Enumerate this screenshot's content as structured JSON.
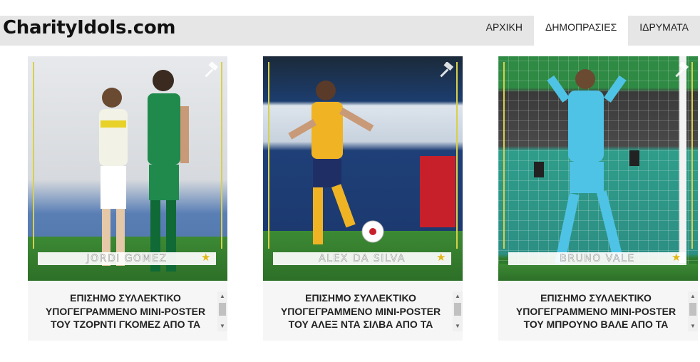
{
  "site": {
    "logo": "CharityIdols.com"
  },
  "nav": [
    {
      "label": "ΑΡΧΙΚΗ"
    },
    {
      "label": "ΔΗΜΟΠΡΑΣΙΕΣ",
      "active": true
    },
    {
      "label": "ΙΔΡΥΜΑΤΑ"
    }
  ],
  "cards": [
    {
      "player_name": "JORDI GOMEZ",
      "title": "ΕΠΙΣΗΜΟ ΣΥΛΛΕΚΤΙΚΟ ΥΠΟΓΕΓΡΑΜΜΕΝΟ MINI-POSTER ΤΟΥ ΤΖΟΡΝΤΙ ΓΚΟΜΕΖ ΑΠΟ ΤΑ"
    },
    {
      "player_name": "ALEX DA SILVA",
      "title": "ΕΠΙΣΗΜΟ ΣΥΛΛΕΚΤΙΚΟ ΥΠΟΓΕΓΡΑΜΜΕΝΟ MINI-POSTER ΤΟΥ ΑΛΕΞ ΝΤΑ ΣΙΛΒΑ ΑΠΟ ΤΑ"
    },
    {
      "player_name": "BRUNO VALE",
      "title": "ΕΠΙΣΗΜΟ ΣΥΛΛΕΚΤΙΚΟ ΥΠΟΓΕΓΡΑΜΜΕΝΟ MINI-POSTER ΤΟΥ ΜΠΡΟΥΝΟ ΒΑΛΕ ΑΠΟ ΤΑ"
    }
  ],
  "icons": {
    "auction": "gavel-icon",
    "badge": "star-icon"
  },
  "colors": {
    "frame": "#d8d04a",
    "star": "#e2b714",
    "topbar": "#e6e6e6"
  }
}
